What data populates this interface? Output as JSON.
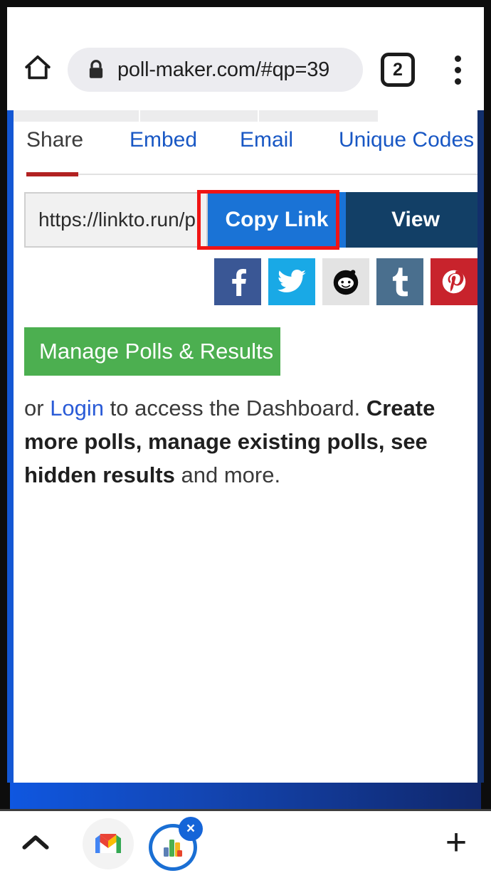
{
  "browser": {
    "home_icon": "home-icon",
    "lock_icon": "lock-icon",
    "url": "poll-maker.com/#qp=39",
    "tab_count": "2",
    "menu_icon": "overflow-menu-icon"
  },
  "page": {
    "tabs": [
      {
        "label": "Share",
        "active": true
      },
      {
        "label": "Embed",
        "active": false
      },
      {
        "label": "Email",
        "active": false
      },
      {
        "label": "Unique Codes",
        "active": false
      }
    ],
    "share": {
      "link_value": "https://linkto.run/p",
      "copy_label": "Copy Link",
      "view_label": "View",
      "highlight_color": "#f01414"
    },
    "social": [
      {
        "name": "facebook",
        "label": "Facebook",
        "color": "#3a5795"
      },
      {
        "name": "twitter",
        "label": "Twitter",
        "color": "#19a9e6"
      },
      {
        "name": "reddit",
        "label": "Reddit",
        "color": "#e3e3e3"
      },
      {
        "name": "tumblr",
        "label": "Tumblr",
        "color": "#4a6f8e"
      },
      {
        "name": "pinterest",
        "label": "Pinterest",
        "color": "#c8232c"
      }
    ],
    "manage_button": {
      "label": "Manage Polls & Results",
      "color": "#4caf50"
    },
    "dashboard_text": {
      "prefix": "or ",
      "link": "Login",
      "middle": " to access the Dashboard. ",
      "bold": "Create more polls, manage existing polls, see hidden results",
      "suffix": " and more."
    },
    "accent_underline_color": "#b22222"
  },
  "bottom_bar": {
    "collapse_icon": "chevron-up-icon",
    "gmail_icon": "gmail-icon",
    "pollmaker_icon": "bar-chart-icon",
    "close_badge": "×",
    "add_icon": "+"
  }
}
